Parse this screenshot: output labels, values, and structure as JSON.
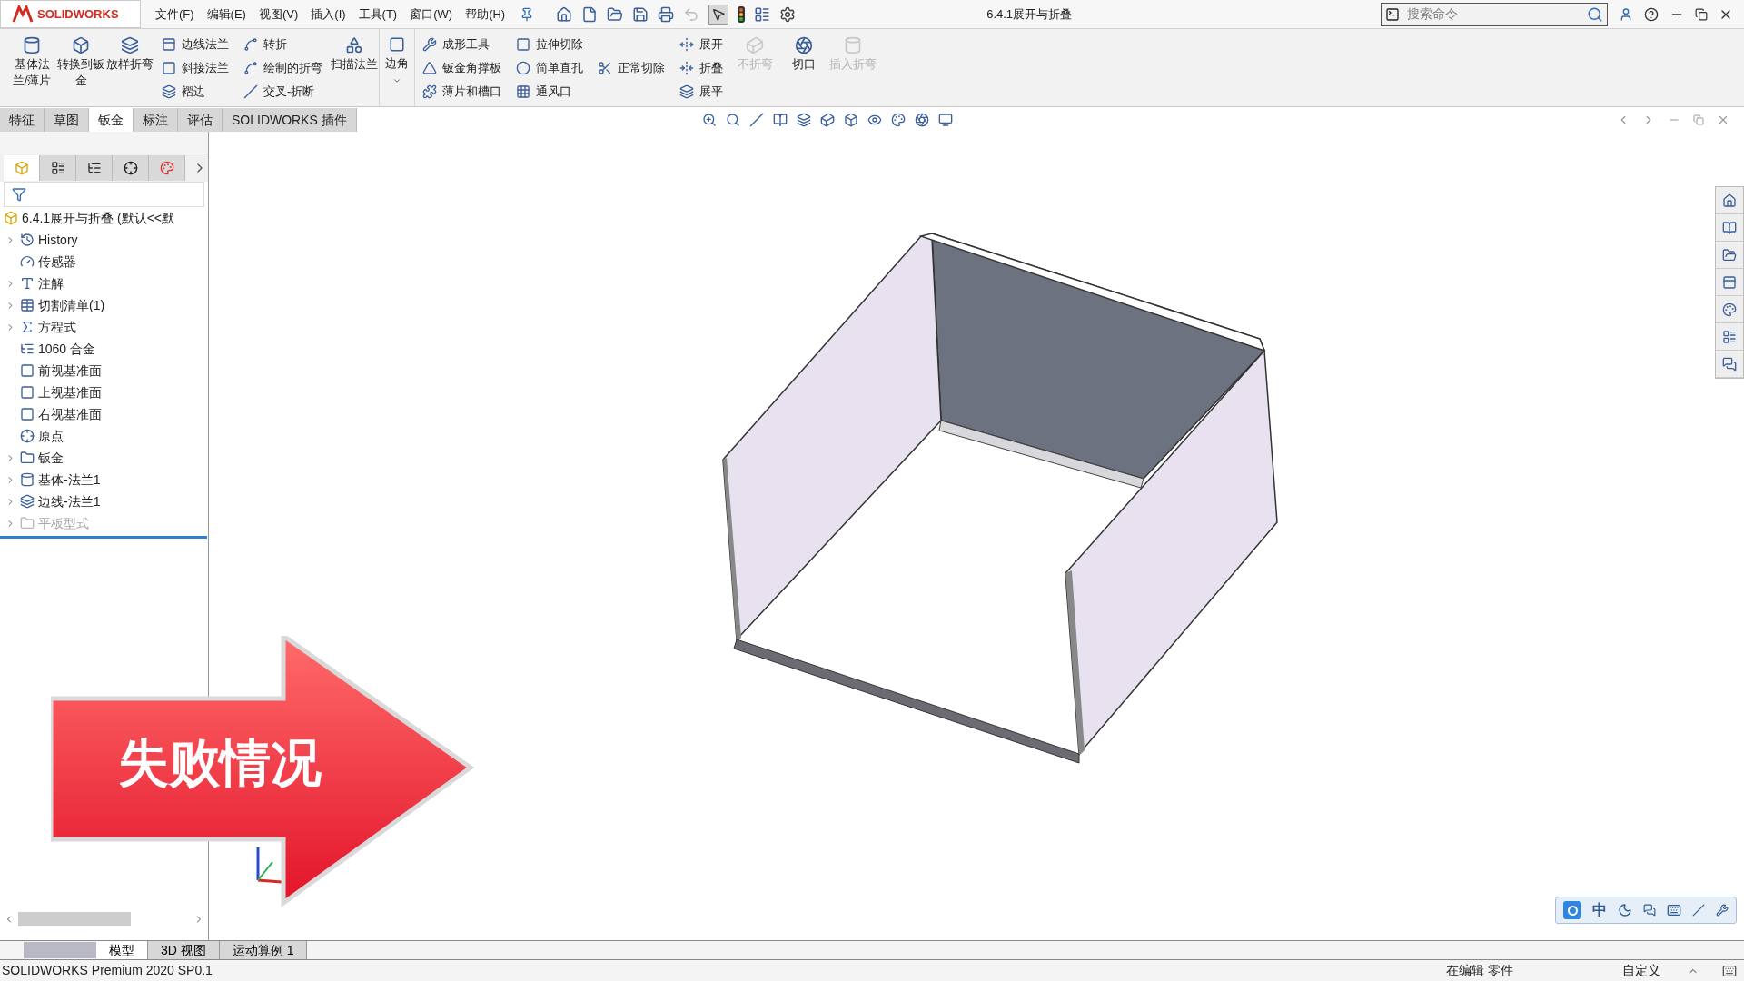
{
  "app": {
    "logo": "SOLIDWORKS",
    "menus": [
      "文件(F)",
      "编辑(E)",
      "视图(V)",
      "插入(I)",
      "工具(T)",
      "窗口(W)",
      "帮助(H)"
    ],
    "document_title": "6.4.1展开与折叠",
    "search": {
      "placeholder": "搜索命令"
    }
  },
  "ribbon": [
    {
      "kind": "large",
      "label": "基体法兰/薄片",
      "disabled": false
    },
    {
      "kind": "large",
      "label": "转换到钣金",
      "disabled": false
    },
    {
      "kind": "large",
      "label": "放样折弯",
      "disabled": false
    },
    {
      "kind": "column",
      "items": [
        {
          "label": "边线法兰",
          "disabled": false
        },
        {
          "label": "斜接法兰",
          "disabled": false
        },
        {
          "label": "褶边",
          "disabled": false
        }
      ]
    },
    {
      "kind": "column",
      "items": [
        {
          "label": "转折",
          "disabled": false
        },
        {
          "label": "绘制的折弯",
          "disabled": false
        },
        {
          "label": "交叉-折断",
          "disabled": false
        }
      ]
    },
    {
      "kind": "large",
      "label": "扫描法兰",
      "disabled": false
    },
    {
      "kind": "dropdown",
      "label": "边角",
      "disabled": false
    },
    {
      "kind": "column",
      "items": [
        {
          "label": "成形工具",
          "disabled": false
        },
        {
          "label": "钣金角撑板",
          "disabled": false
        },
        {
          "label": "薄片和槽口",
          "disabled": false
        }
      ]
    },
    {
      "kind": "column",
      "items": [
        {
          "label": "拉伸切除",
          "disabled": false
        },
        {
          "label": "简单直孔",
          "disabled": false
        },
        {
          "label": "通风口",
          "disabled": false
        }
      ]
    },
    {
      "kind": "column",
      "items": [
        {
          "label": "正常切除",
          "disabled": false
        }
      ]
    },
    {
      "kind": "column",
      "items": [
        {
          "label": "展开",
          "disabled": false
        },
        {
          "label": "折叠",
          "disabled": false
        },
        {
          "label": "展平",
          "disabled": false
        }
      ]
    },
    {
      "kind": "large",
      "label": "不折弯",
      "disabled": true
    },
    {
      "kind": "large",
      "label": "切口",
      "disabled": false
    },
    {
      "kind": "large",
      "label": "插入折弯",
      "disabled": true
    }
  ],
  "tabs": [
    {
      "label": "特征",
      "selected": false
    },
    {
      "label": "草图",
      "selected": false
    },
    {
      "label": "钣金",
      "selected": true
    },
    {
      "label": "标注",
      "selected": false
    },
    {
      "label": "评估",
      "selected": false
    },
    {
      "label": "SOLIDWORKS 插件",
      "selected": false
    }
  ],
  "panel_tabs": [
    {
      "selected": true
    },
    {
      "selected": false
    },
    {
      "selected": false
    },
    {
      "selected": false
    },
    {
      "selected": false
    }
  ],
  "feature_tree": {
    "root": "6.4.1展开与折叠 (默认<<默",
    "items": [
      {
        "kind": "history",
        "label": "History",
        "expandable": true,
        "disabled": false
      },
      {
        "kind": "sensor",
        "label": "传感器",
        "expandable": false,
        "disabled": false
      },
      {
        "kind": "annotation",
        "label": "注解",
        "expandable": true,
        "disabled": false
      },
      {
        "kind": "cutlist",
        "label": "切割清单(1)",
        "expandable": true,
        "disabled": false
      },
      {
        "kind": "equation",
        "label": "方程式",
        "expandable": true,
        "disabled": false
      },
      {
        "kind": "material",
        "label": "1060 合金",
        "expandable": false,
        "disabled": false
      },
      {
        "kind": "plane",
        "label": "前视基准面",
        "expandable": false,
        "disabled": false
      },
      {
        "kind": "plane",
        "label": "上视基准面",
        "expandable": false,
        "disabled": false
      },
      {
        "kind": "plane",
        "label": "右视基准面",
        "expandable": false,
        "disabled": false
      },
      {
        "kind": "origin",
        "label": "原点",
        "expandable": false,
        "disabled": false
      },
      {
        "kind": "sheetmetal",
        "label": "钣金",
        "expandable": true,
        "disabled": false
      },
      {
        "kind": "flange",
        "label": "基体-法兰1",
        "expandable": true,
        "disabled": false
      },
      {
        "kind": "edgeflange",
        "label": "边线-法兰1",
        "expandable": true,
        "disabled": false
      },
      {
        "kind": "flatpattern",
        "label": "平板型式",
        "expandable": true,
        "disabled": true
      }
    ]
  },
  "overlay": {
    "caption": "失败情况"
  },
  "ime_bar": {
    "mode": "中"
  },
  "bottom_tabs": [
    {
      "label": "模型",
      "selected": true
    },
    {
      "label": "3D 视图",
      "selected": false
    },
    {
      "label": "运动算例 1",
      "selected": false
    }
  ],
  "status_bar": {
    "product": "SOLIDWORKS Premium 2020 SP0.1",
    "state": "在编辑 零件",
    "units": "自定义"
  }
}
